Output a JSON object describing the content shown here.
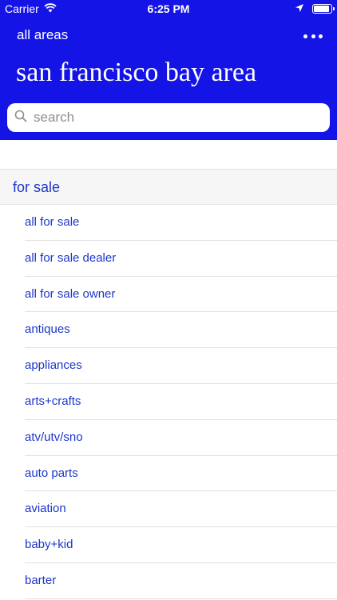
{
  "status_bar": {
    "carrier": "Carrier",
    "time": "6:25 PM"
  },
  "nav": {
    "back_label": "all areas",
    "more_icon": "more-horizontal-icon"
  },
  "site_title": "san francisco bay area",
  "search": {
    "placeholder": "search",
    "value": ""
  },
  "section": {
    "title": "for sale",
    "items": [
      {
        "label": "all for sale"
      },
      {
        "label": "all for sale dealer"
      },
      {
        "label": "all for sale owner"
      },
      {
        "label": "antiques"
      },
      {
        "label": "appliances"
      },
      {
        "label": "arts+crafts"
      },
      {
        "label": "atv/utv/sno"
      },
      {
        "label": "auto parts"
      },
      {
        "label": "aviation"
      },
      {
        "label": "baby+kid"
      },
      {
        "label": "barter"
      }
    ]
  },
  "colors": {
    "header_bg": "#1414e6",
    "link": "#1c36c8",
    "section_bg": "#f6f6f6"
  }
}
